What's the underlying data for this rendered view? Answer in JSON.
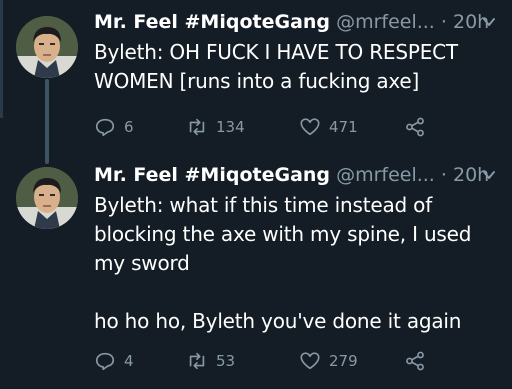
{
  "tweets": [
    {
      "display_name": "Mr. Feel #MiqoteGang",
      "handle": "@mrfeel...",
      "separator": "·",
      "time": "20h",
      "text": "Byleth: OH FUCK I HAVE TO RESPECT WOMEN [runs into a fucking axe]",
      "replies": "6",
      "retweets": "134",
      "likes": "471"
    },
    {
      "display_name": "Mr. Feel #MiqoteGang",
      "handle": "@mrfeel...",
      "separator": "·",
      "time": "20h",
      "text": "Byleth: what if this time instead of blocking the axe with my spine, I used my sword\n\nho ho ho, Byleth you've done it again",
      "replies": "4",
      "retweets": "53",
      "likes": "279"
    }
  ],
  "icons": {
    "reply": "reply-icon",
    "retweet": "retweet-icon",
    "like": "heart-icon",
    "share": "share-icon",
    "more": "chevron-down-icon"
  },
  "colors": {
    "background": "#141d26",
    "secondary_text": "#8899a6",
    "thread_line": "#3d5466"
  }
}
